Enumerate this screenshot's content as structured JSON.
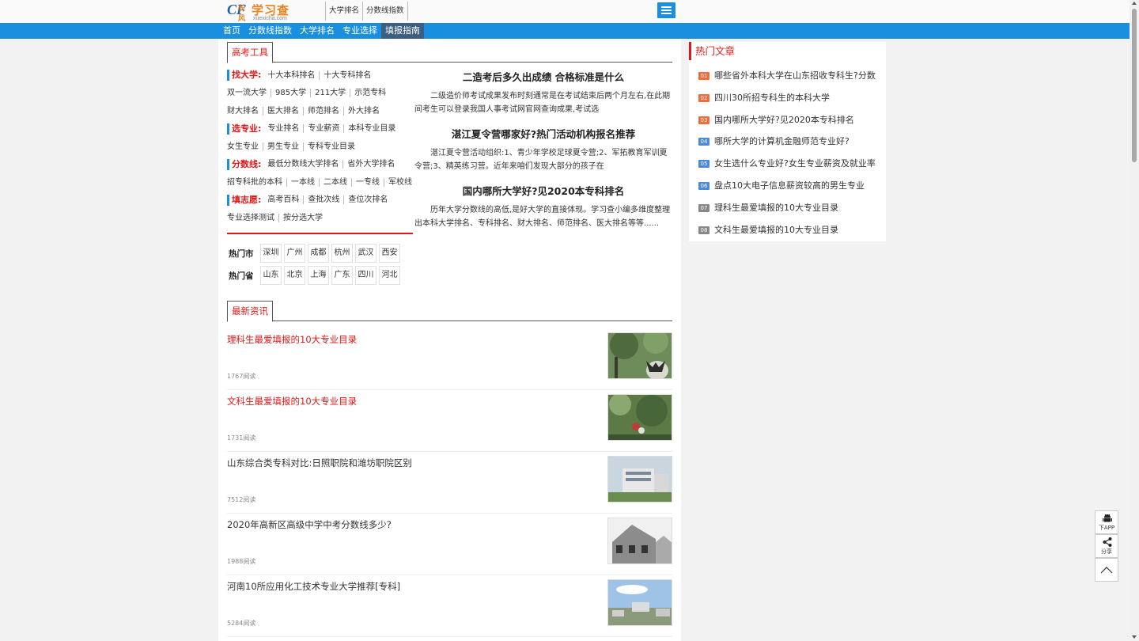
{
  "header": {
    "logo_mark": "CF",
    "logo_mark_small": "长风",
    "logo_name": "学习查",
    "logo_domain": "xuexicha.com",
    "top_links": [
      "大学排名",
      "分数线指数"
    ],
    "menu_icon": "menu-icon"
  },
  "nav": [
    "首页",
    "分数线指数",
    "大学排名",
    "专业选择",
    "填报指南"
  ],
  "nav_active": "填报指南",
  "tools": {
    "tab": "高考工具",
    "rows": [
      {
        "cat": "找大学:",
        "links": [
          "十大本科排名",
          "十大专科排名"
        ]
      },
      {
        "cat": "",
        "links": [
          "双一流大学",
          "985大学",
          "211大学",
          "示范专科"
        ]
      },
      {
        "cat": "",
        "links": [
          "财大排名",
          "医大排名",
          "师范排名",
          "外大排名"
        ]
      },
      {
        "cat": "选专业:",
        "links": [
          "专业排名",
          "专业薪资",
          "本科专业目录"
        ]
      },
      {
        "cat": "",
        "links": [
          "女生专业",
          "男生专业",
          "专科专业目录"
        ]
      },
      {
        "cat": "分数线:",
        "links": [
          "最低分数线大学排名",
          "省外大学排名"
        ]
      },
      {
        "cat": "",
        "links": [
          "招专科批的本科",
          "一本线",
          "二本线",
          "一专线",
          "军校线"
        ]
      },
      {
        "cat": "填志愿:",
        "links": [
          "高考百科",
          "查批次线",
          "查位次排名"
        ]
      },
      {
        "cat": "",
        "links": [
          "专业选择测试",
          "按分选大学"
        ]
      }
    ],
    "hot_city_label": "热门市",
    "hot_cities": [
      "深圳",
      "广州",
      "成都",
      "杭州",
      "武汉",
      "西安"
    ],
    "hot_prov_label": "热门省",
    "hot_provs": [
      "山东",
      "北京",
      "上海",
      "广东",
      "四川",
      "河北"
    ]
  },
  "featured": [
    {
      "title": "二造考后多久出成绩 合格标准是什么",
      "summary": "二级造价师考试成果发布时刻通常是在考试结束后两个月左右,在此期间考生可以登录我国人事考试网官网查询成果,考试选"
    },
    {
      "title": "湛江夏令营哪家好?热门活动机构报名推荐",
      "summary": "湛江夏令营活动组织:1、青少年学校足球夏令营;2、军拓教育军训夏令营;3、精英练习营。近年来咱们发现大部分的孩子在"
    },
    {
      "title": "国内哪所大学好?见2020本专科排名",
      "summary": "历年大学分数线的高低,是好大学的直接体现。学习查小编多维度整理出本科大学排名、专科排名、财大排名、师范排名、医大排名等等......"
    }
  ],
  "news": {
    "tab": "最新资讯",
    "items": [
      {
        "title": "理科生最爱填报的10大专业目录",
        "reads": "1767阅读",
        "red": true
      },
      {
        "title": "文科生最爱填报的10大专业目录",
        "reads": "1731阅读",
        "red": true
      },
      {
        "title": "山东综合类专科对比:日照职院和潍坊职院区别",
        "reads": "7512阅读",
        "red": false
      },
      {
        "title": "2020年高新区高级中学中考分数线多少?",
        "reads": "1988阅读",
        "red": false
      },
      {
        "title": "河南10所应用化工技术专业大学推荐[专科]",
        "reads": "5284阅读",
        "red": false
      }
    ]
  },
  "side": {
    "title": "热门文章",
    "items": [
      {
        "num": "01",
        "text": "哪些省外本科大学在山东招收专科生?分数",
        "color": "#f26b3a"
      },
      {
        "num": "02",
        "text": "四川30所招专科生的本科大学",
        "color": "#f26b3a"
      },
      {
        "num": "03",
        "text": "国内哪所大学好?见2020本专科排名",
        "color": "#f26b3a"
      },
      {
        "num": "04",
        "text": "哪所大学的计算机金融师范专业好?",
        "color": "#4a89dc"
      },
      {
        "num": "05",
        "text": "女生选什么专业好?女生专业薪资及就业率",
        "color": "#4a89dc"
      },
      {
        "num": "06",
        "text": "盘点10大电子信息薪资较高的男生专业",
        "color": "#4a89dc"
      },
      {
        "num": "07",
        "text": "理科生最爱填报的10大专业目录",
        "color": "#888888"
      },
      {
        "num": "08",
        "text": "文科生最爱填报的10大专业目录",
        "color": "#888888"
      }
    ]
  },
  "float": {
    "app_label": "下APP",
    "share_label": "分享"
  }
}
